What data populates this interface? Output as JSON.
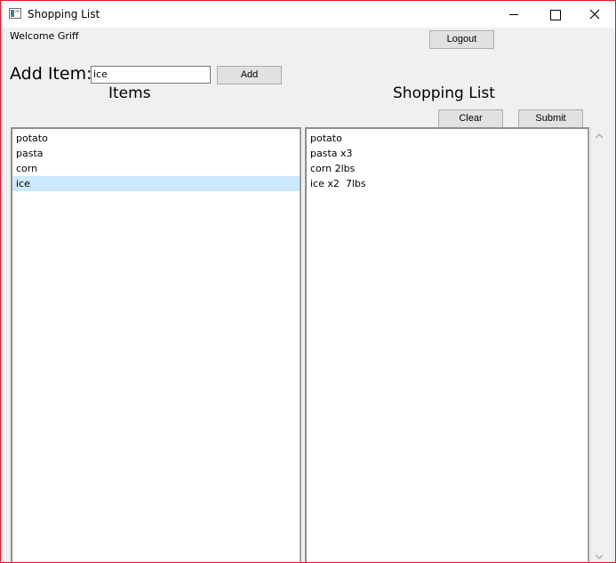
{
  "window": {
    "title": "Shopping List"
  },
  "header": {
    "welcome": "Welcome Griff",
    "logout_label": "Logout"
  },
  "add_row": {
    "label": "Add Item:",
    "input_value": "ice",
    "add_label": "Add"
  },
  "items_panel": {
    "heading": "Items",
    "items": [
      "potato",
      "pasta",
      "corn",
      "ice"
    ],
    "selected": "ice"
  },
  "shopping_panel": {
    "heading": "Shopping List",
    "clear_label": "Clear",
    "submit_label": "Submit",
    "items": [
      "potato",
      "pasta x3",
      "corn 2lbs",
      "ice x2  7lbs"
    ]
  },
  "colors": {
    "window_border": "#e81123",
    "selection": "#cce8ff",
    "button_bg": "#e1e1e1"
  }
}
